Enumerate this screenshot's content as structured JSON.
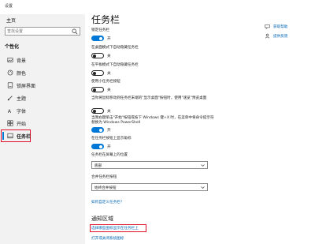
{
  "window": {
    "title": "设置"
  },
  "sidebar": {
    "home": "主页",
    "search_placeholder": "查找设置",
    "section": "个性化",
    "items": [
      {
        "label": "背景",
        "icon": "picture-icon"
      },
      {
        "label": "颜色",
        "icon": "palette-icon"
      },
      {
        "label": "锁屏界面",
        "icon": "lock-screen-icon"
      },
      {
        "label": "主题",
        "icon": "brush-icon"
      },
      {
        "label": "字体",
        "icon": "font-icon"
      },
      {
        "label": "开始",
        "icon": "start-icon"
      },
      {
        "label": "任务栏",
        "icon": "taskbar-icon",
        "selected": true
      }
    ]
  },
  "main": {
    "title": "任务栏",
    "settings": [
      {
        "label": "锁定任务栏",
        "state": "开",
        "on": true
      },
      {
        "label": "在桌面模式下自动隐藏任务栏",
        "state": "关",
        "on": false
      },
      {
        "label": "在平板模式下自动隐藏任务栏",
        "state": "关",
        "on": false
      },
      {
        "label": "使用小任务栏按钮",
        "state": "关",
        "on": false
      },
      {
        "label": "当你将鼠标移动到任务栏末端的\"显示桌面\"按钮时，使用\"速览\"预览桌面",
        "state": "关",
        "on": false
      },
      {
        "label": "当我右键单击\"开始\"按钮或按下 Windows 键+X 时，在菜单中将命令提示符替换为 Windows PowerShell",
        "state": "开",
        "on": true
      },
      {
        "label": "在任务栏按钮上显示角标",
        "state": "开",
        "on": true
      }
    ],
    "position_label": "任务栏在屏幕上的位置",
    "position_value": "底部",
    "combine_label": "合并任务栏按钮",
    "combine_value": "始终合并按钮",
    "customize_link": "如何自定义任务栏?",
    "notification_title": "通知区域",
    "notification_links": [
      "选择哪些图标显示在任务栏上",
      "打开或关闭系统图标"
    ]
  },
  "help": {
    "get_help": "获取帮助",
    "feedback": "提供反馈"
  },
  "colors": {
    "accent": "#0078d7",
    "highlight": "#e0102a",
    "link": "#0066b4"
  }
}
